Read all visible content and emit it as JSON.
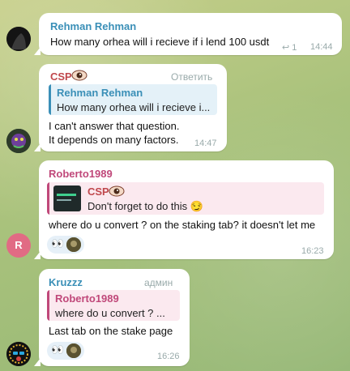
{
  "messages": [
    {
      "sender": "Rehman Rehman",
      "text": "How many orhea will i recieve if i lend 100 usdt",
      "reply_count": "1",
      "time": "14:44"
    },
    {
      "sender": "CSP",
      "reply_action": "Ответить",
      "quote_name": "Rehman Rehman",
      "quote_text": "How many orhea will i recieve i...",
      "text_line1": "I can't answer that question.",
      "text_line2": "It depends on many factors.",
      "time": "14:47"
    },
    {
      "sender": "Roberto1989",
      "quote_name": "CSP",
      "quote_text": "Don't forget to do this 😏",
      "text": "where do u convert ? on the staking tab? it doesn't let me",
      "reaction": "👀",
      "time": "16:23",
      "avatar_letter": "R"
    },
    {
      "sender": "Kruzzz",
      "role": "админ",
      "quote_name": "Roberto1989",
      "quote_text": "where do u convert ? ...",
      "text": "Last tab on the stake page",
      "reaction": "👀",
      "time": "16:26"
    }
  ],
  "colors": {
    "rehman": "#3a8fb7",
    "csp": "#c0484d",
    "roberto": "#c0487a",
    "kruzzz": "#3a8fb7",
    "avatar_r": "#e16b84"
  }
}
